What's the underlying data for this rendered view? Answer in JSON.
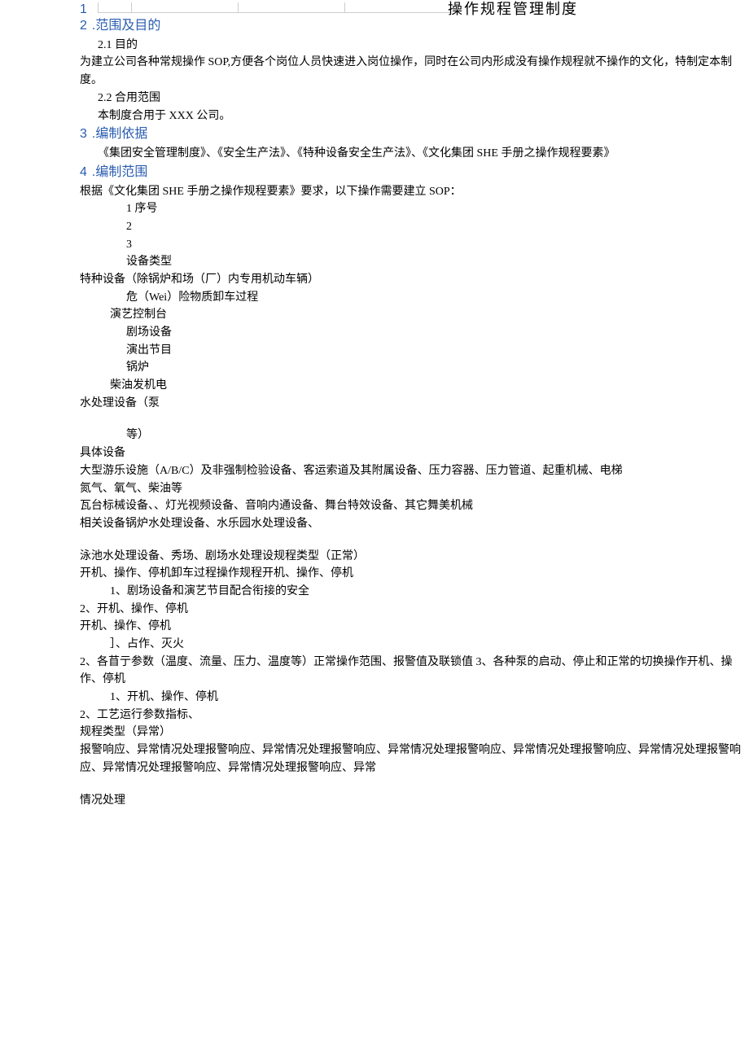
{
  "title_bar": {
    "num": "1",
    "text": "操作规程管理制度"
  },
  "s2": {
    "heading_num": "2",
    "heading": ".范围及目的",
    "p1": "2.1 目的",
    "p2": "为建立公司各种常规操作 SOP,方便各个岗位人员快速进入岗位操作，同时在公司内形成没有操作规程就不操作的文化，特制定本制度。",
    "p3": "2.2 合用范围",
    "p4": "本制度合用于 XXX 公司。"
  },
  "s3": {
    "heading_num": "3",
    "heading": ".编制依据",
    "p1": "《集团安全管理制度》、《安全生产法》、《特种设备安全生产法》、《文化集团 SHE 手册之操作规程要素》"
  },
  "s4": {
    "heading_num": "4",
    "heading": ".编制范围",
    "p1": "根据《文化集团 SHE 手册之操作规程要素》要求，以下操作需要建立 SOP：",
    "n1": "1 序号",
    "n2": "2",
    "n3": "3",
    "n4": "设备类型",
    "l1": "特种设备（除锅炉和场（厂）内专用机动车辆）",
    "l2": "危（Wei）险物质卸车过程",
    "l3": "演艺控制台",
    "l4": "剧场设备",
    "l5": "演出节目",
    "l6": "锅炉",
    "l7": "柴油发机电",
    "l8": "水处理设备（泵",
    "l9": "等）",
    "b1": "具体设备",
    "b2": "大型游乐设施（A/B/C）及非强制检验设备、客运索道及其附属设备、压力容器、压力管道、起重机械、电梯",
    "b3": "氮气、氧气、柴油等",
    "b4": "瓦台标械设备、、灯光视频设备、音响内通设备、舞台特效设备、其它舞美机械",
    "b5": "相关设备锅炉水处理设备、水乐园水处理设备、",
    "b6": "泳池水处理设备、秀场、剧场水处理设规程类型（正常）",
    "c1": "开机、操作、停机卸车过程操作规程开机、操作、停机",
    "c2": "1、剧场设备和演艺节目配合衔接的安全",
    "c3": "2、开机、操作、停机",
    "c4": "开机、操作、停机",
    "c5": "］、占作、灭火",
    "c6": "2、各苜亍参数（温度、流量、压力、温度等）正常操作范围、报警值及联锁值 3、各种泵的启动、停止和正常的切换操作开机、操作、停机",
    "c7": "1、开机、操作、停机",
    "c8": "2、工艺运行参数指标、",
    "d1": "规程类型（异常）",
    "d2": "报警响应、异常情况处理报警响应、异常情况处理报警响应、异常情况处理报警响应、异常情况处理报警响应、异常情况处理报警响应、异常情况处理报警响应、异常情况处理报警响应、异常",
    "d3": "情况处理"
  }
}
